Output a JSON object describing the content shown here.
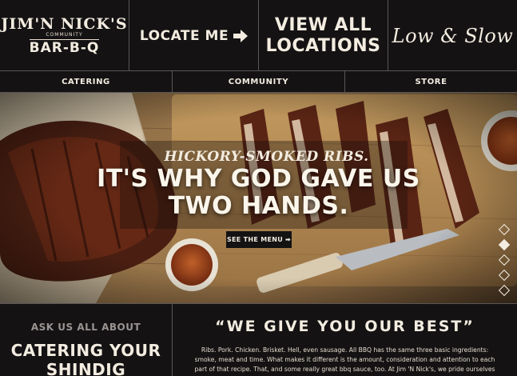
{
  "header": {
    "logo_top": "JIM'N NICK'S",
    "logo_mid": "COMMUNITY",
    "logo_bottom": "BAR-B-Q",
    "locate_label": "LOCATE ME",
    "view_all_line1": "VIEW ALL",
    "view_all_line2": "LOCATIONS",
    "tagline": "Low & Slow"
  },
  "nav": {
    "items": [
      {
        "label": "CATERING"
      },
      {
        "label": "COMMUNITY"
      },
      {
        "label": "STORE"
      }
    ]
  },
  "hero": {
    "kicker": "HICKORY-SMOKED RIBS.",
    "headline_line1": "IT'S WHY GOD GAVE US",
    "headline_line2": "TWO HANDS.",
    "cta_label": "SEE THE MENU",
    "cta_arrow": "➡",
    "slides_count": 5,
    "active_slide": 2
  },
  "catering": {
    "kicker": "ASK US ALL ABOUT",
    "title_line1": "CATERING YOUR",
    "title_line2": "SHINDIG"
  },
  "about": {
    "quote": "“WE GIVE YOU OUR BEST”",
    "body": "Ribs. Pork. Chicken. Brisket. Hell, even sausage. All BBQ has the same three basic ingredients: smoke, meat and time. What makes it different is the amount, consideration and attention to each part of that recipe. That, and some really great bbq sauce, too. At Jim 'N Nick's, we pride ourselves on using the right ingredients, taking our time and honoring the traditions that brought"
  },
  "colors": {
    "background": "#141213",
    "text": "#f3ece0",
    "divider": "#5a5657",
    "muted": "#9a9492"
  }
}
